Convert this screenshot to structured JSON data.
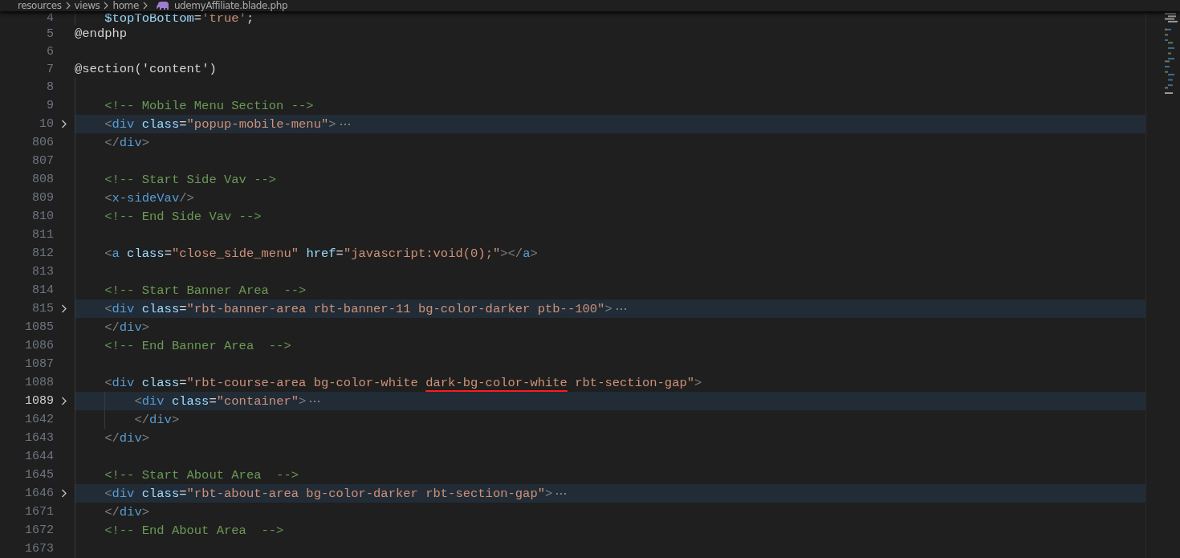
{
  "breadcrumb": {
    "folders": [
      "resources",
      "views",
      "home"
    ],
    "file": "udemyAffiliate.blade.php"
  },
  "lines": [
    {
      "children": [
        {
          "number": "4",
          "folded": false,
          "current": false,
          "tokens": [
            {
              "kind": "var",
              "text": "$topToBottom"
            },
            {
              "kind": "plain",
              "text": "="
            },
            {
              "kind": "str",
              "text": "'true'"
            },
            {
              "kind": "plain",
              "text": ";"
            }
          ]
        }
      ]
    },
    {
      "number": "5",
      "folded": false,
      "current": false,
      "tokens": [
        {
          "kind": "plain",
          "text": "@endphp"
        }
      ]
    },
    {
      "number": "6",
      "folded": false,
      "current": false
    },
    {
      "number": "7",
      "folded": false,
      "current": false,
      "tokens": [
        {
          "kind": "plain",
          "text": "@section('content')"
        }
      ],
      "children": [
        {
          "number": "8",
          "folded": false,
          "current": false
        },
        {
          "number": "9",
          "folded": false,
          "current": false,
          "tokens": [
            {
              "kind": "comment",
              "text": "<!-- Mobile Menu Section -->"
            }
          ]
        },
        {
          "number": "10",
          "folded": true,
          "current": false,
          "tokens": [
            {
              "kind": "punct",
              "text": "<"
            },
            {
              "kind": "tag",
              "text": "div"
            },
            {
              "kind": "attr",
              "text": " class"
            },
            {
              "kind": "plain",
              "text": "="
            },
            {
              "kind": "str",
              "text": "\"popup-mobile-menu\""
            },
            {
              "kind": "punct",
              "text": ">"
            }
          ]
        },
        {
          "number": "806",
          "folded": false,
          "current": false,
          "tokens": [
            {
              "kind": "punct",
              "text": "</"
            },
            {
              "kind": "tag",
              "text": "div"
            },
            {
              "kind": "punct",
              "text": ">"
            }
          ]
        },
        {
          "number": "807",
          "folded": false,
          "current": false
        },
        {
          "number": "808",
          "folded": false,
          "current": false,
          "tokens": [
            {
              "kind": "comment",
              "text": "<!-- Start Side Vav -->"
            }
          ]
        },
        {
          "number": "809",
          "folded": false,
          "current": false,
          "tokens": [
            {
              "kind": "punct",
              "text": "<"
            },
            {
              "kind": "tag",
              "text": "x-sideVav"
            },
            {
              "kind": "punct",
              "text": "/>"
            }
          ]
        },
        {
          "number": "810",
          "folded": false,
          "current": false,
          "tokens": [
            {
              "kind": "comment",
              "text": "<!-- End Side Vav -->"
            }
          ]
        },
        {
          "number": "811",
          "folded": false,
          "current": false
        },
        {
          "number": "812",
          "folded": false,
          "current": false,
          "tokens": [
            {
              "kind": "punct",
              "text": "<"
            },
            {
              "kind": "tag",
              "text": "a"
            },
            {
              "kind": "attr",
              "text": " class"
            },
            {
              "kind": "plain",
              "text": "="
            },
            {
              "kind": "str",
              "text": "\"close_side_menu\""
            },
            {
              "kind": "attr",
              "text": " href"
            },
            {
              "kind": "plain",
              "text": "="
            },
            {
              "kind": "str",
              "text": "\"javascript:void(0);\""
            },
            {
              "kind": "punct",
              "text": "></"
            },
            {
              "kind": "tag",
              "text": "a"
            },
            {
              "kind": "punct",
              "text": ">"
            }
          ]
        },
        {
          "number": "813",
          "folded": false,
          "current": false
        },
        {
          "number": "814",
          "folded": false,
          "current": false,
          "tokens": [
            {
              "kind": "comment",
              "text": "<!-- Start Banner Area  -->"
            }
          ]
        },
        {
          "number": "815",
          "folded": true,
          "current": false,
          "tokens": [
            {
              "kind": "punct",
              "text": "<"
            },
            {
              "kind": "tag",
              "text": "div"
            },
            {
              "kind": "attr",
              "text": " class"
            },
            {
              "kind": "plain",
              "text": "="
            },
            {
              "kind": "str",
              "text": "\"rbt-banner-area rbt-banner-11 bg-color-darker ptb--100\""
            },
            {
              "kind": "punct",
              "text": ">"
            }
          ]
        },
        {
          "number": "1085",
          "folded": false,
          "current": false,
          "tokens": [
            {
              "kind": "punct",
              "text": "</"
            },
            {
              "kind": "tag",
              "text": "div"
            },
            {
              "kind": "punct",
              "text": ">"
            }
          ]
        },
        {
          "number": "1086",
          "folded": false,
          "current": false,
          "tokens": [
            {
              "kind": "comment",
              "text": "<!-- End Banner Area  -->"
            }
          ]
        },
        {
          "number": "1087",
          "folded": false,
          "current": false
        },
        {
          "number": "1088",
          "folded": false,
          "current": false,
          "tokens": [
            {
              "kind": "punct",
              "text": "<"
            },
            {
              "kind": "tag",
              "text": "div"
            },
            {
              "kind": "attr",
              "text": " class"
            },
            {
              "kind": "plain",
              "text": "="
            },
            {
              "kind": "str",
              "text": "\"rbt-course-area bg-color-white "
            },
            {
              "kind": "str",
              "text": "dark-bg-color-white",
              "underlined": true
            },
            {
              "kind": "str",
              "text": " rbt-section-gap\""
            },
            {
              "kind": "punct",
              "text": ">"
            }
          ],
          "children": [
            {
              "number": "1089",
              "folded": true,
              "current": true,
              "tokens": [
                {
                  "kind": "punct",
                  "text": "<"
                },
                {
                  "kind": "tag",
                  "text": "div"
                },
                {
                  "kind": "attr",
                  "text": " class"
                },
                {
                  "kind": "plain",
                  "text": "="
                },
                {
                  "kind": "str",
                  "text": "\"container\""
                },
                {
                  "kind": "punct",
                  "text": ">"
                }
              ]
            },
            {
              "number": "1642",
              "folded": false,
              "current": false,
              "tokens": [
                {
                  "kind": "punct",
                  "text": "</"
                },
                {
                  "kind": "tag",
                  "text": "div"
                },
                {
                  "kind": "punct",
                  "text": ">"
                }
              ]
            }
          ]
        },
        {
          "number": "1643",
          "folded": false,
          "current": false,
          "tokens": [
            {
              "kind": "punct",
              "text": "</"
            },
            {
              "kind": "tag",
              "text": "div"
            },
            {
              "kind": "punct",
              "text": ">"
            }
          ]
        },
        {
          "number": "1644",
          "folded": false,
          "current": false
        },
        {
          "number": "1645",
          "folded": false,
          "current": false,
          "tokens": [
            {
              "kind": "comment",
              "text": "<!-- Start About Area  -->"
            }
          ]
        },
        {
          "number": "1646",
          "folded": true,
          "current": false,
          "tokens": [
            {
              "kind": "punct",
              "text": "<"
            },
            {
              "kind": "tag",
              "text": "div"
            },
            {
              "kind": "attr",
              "text": " class"
            },
            {
              "kind": "plain",
              "text": "="
            },
            {
              "kind": "str",
              "text": "\"rbt-about-area bg-color-darker rbt-section-gap\""
            },
            {
              "kind": "punct",
              "text": ">"
            }
          ]
        },
        {
          "number": "1671",
          "folded": false,
          "current": false,
          "tokens": [
            {
              "kind": "punct",
              "text": "</"
            },
            {
              "kind": "tag",
              "text": "div"
            },
            {
              "kind": "punct",
              "text": ">"
            }
          ]
        },
        {
          "number": "1672",
          "folded": false,
          "current": false,
          "tokens": [
            {
              "kind": "comment",
              "text": "<!-- End About Area  -->"
            }
          ]
        },
        {
          "number": "1673",
          "folded": false,
          "current": false
        }
      ]
    }
  ]
}
